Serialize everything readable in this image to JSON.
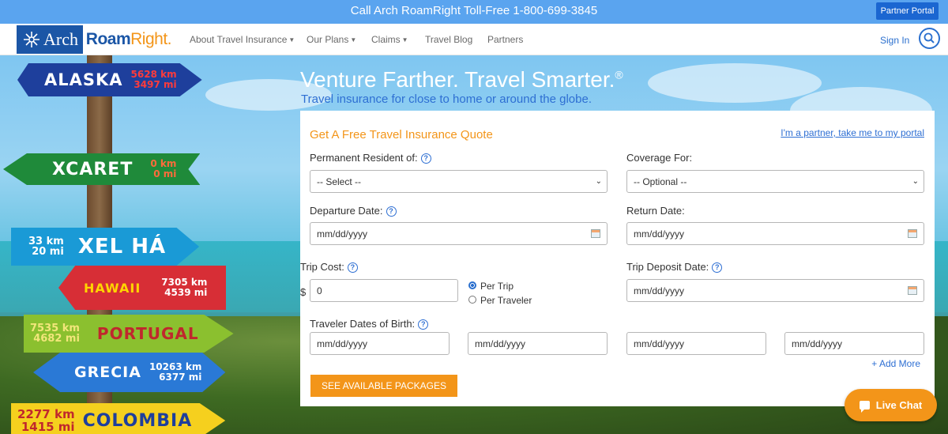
{
  "topbar": {
    "call_text": "Call Arch RoamRight Toll-Free  1-800-699-3845",
    "partner_portal": "Partner Portal"
  },
  "logo": {
    "arch": "Arch",
    "roam": "Roam",
    "right": "Right."
  },
  "nav": {
    "items": [
      {
        "label": "About Travel Insurance",
        "caret": true
      },
      {
        "label": "Our Plans",
        "caret": true
      },
      {
        "label": "Claims",
        "caret": true
      },
      {
        "label": "Travel Blog",
        "caret": false
      },
      {
        "label": "Partners",
        "caret": false
      }
    ],
    "sign_in": "Sign In"
  },
  "hero": {
    "headline": "Venture Farther. Travel Smarter.",
    "headline_mark": "®",
    "subheadline": "Travel insurance for close to home or around the globe.",
    "signs": [
      {
        "name": "ALASKA",
        "dist": [
          "5628 km",
          "3497 mi"
        ]
      },
      {
        "name": "XCARET",
        "dist": [
          "0 km",
          "0 mi"
        ]
      },
      {
        "name": "XEL HÁ",
        "dist": [
          "33 km",
          "20 mi"
        ]
      },
      {
        "name": "HAWAII",
        "dist": [
          "7305 km",
          "4539 mi"
        ]
      },
      {
        "name": "PORTUGAL",
        "dist": [
          "7535 km",
          "4682 mi"
        ]
      },
      {
        "name": "GRECIA",
        "dist": [
          "10263 km",
          "6377 mi"
        ]
      },
      {
        "name": "COLOMBIA",
        "dist": [
          "2277 km",
          "1415 mi"
        ]
      }
    ]
  },
  "form": {
    "title": "Get A Free Travel Insurance Quote",
    "partner_link": "I'm a partner, take me to my portal",
    "resident_label": "Permanent Resident of:",
    "resident_value": "-- Select --",
    "coverage_label": "Coverage For:",
    "coverage_value": "-- Optional --",
    "departure_label": "Departure Date:",
    "departure_placeholder": "mm/dd/yyyy",
    "return_label": "Return Date:",
    "return_placeholder": "mm/dd/yyyy",
    "trip_cost_label": "Trip Cost:",
    "currency": "$",
    "trip_cost_value": "0",
    "per_trip": "Per Trip",
    "per_traveler": "Per Traveler",
    "deposit_label": "Trip Deposit Date:",
    "deposit_placeholder": "mm/dd/yyyy",
    "dob_label": "Traveler Dates of Birth:",
    "dob_placeholders": [
      "mm/dd/yyyy",
      "mm/dd/yyyy",
      "mm/dd/yyyy",
      "mm/dd/yyyy"
    ],
    "add_more": "+ Add More",
    "submit": "SEE AVAILABLE PACKAGES",
    "help_glyph": "?"
  },
  "live_chat": "Live Chat",
  "colors": {
    "accent_orange": "#f39519",
    "link_blue": "#2e6fd3",
    "topbar_blue": "#5aa4ef"
  }
}
